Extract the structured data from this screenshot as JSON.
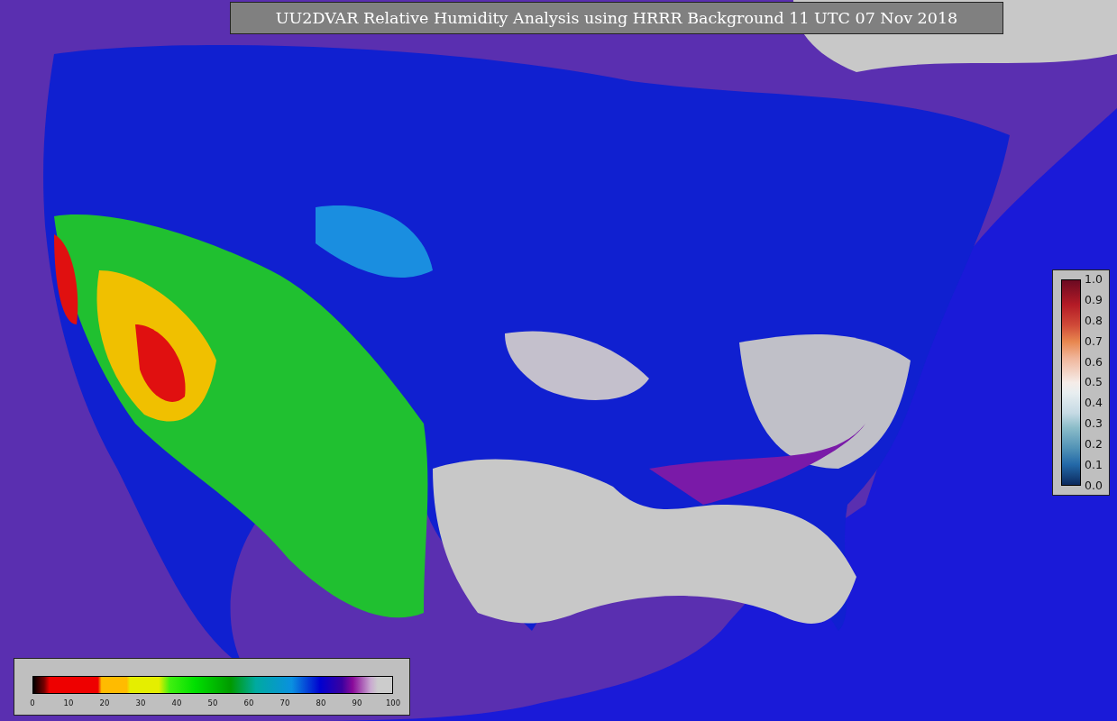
{
  "title": "UU2DVAR Relative Humidity Analysis using HRRR Background 11 UTC 07 Nov 2018",
  "legend_vertical": {
    "ticks": [
      "1.0",
      "0.9",
      "0.8",
      "0.7",
      "0.6",
      "0.5",
      "0.4",
      "0.3",
      "0.2",
      "0.1",
      "0.0"
    ]
  },
  "legend_horizontal": {
    "ticks": [
      "0",
      "10",
      "20",
      "30",
      "40",
      "50",
      "60",
      "70",
      "80",
      "90",
      "100"
    ]
  }
}
